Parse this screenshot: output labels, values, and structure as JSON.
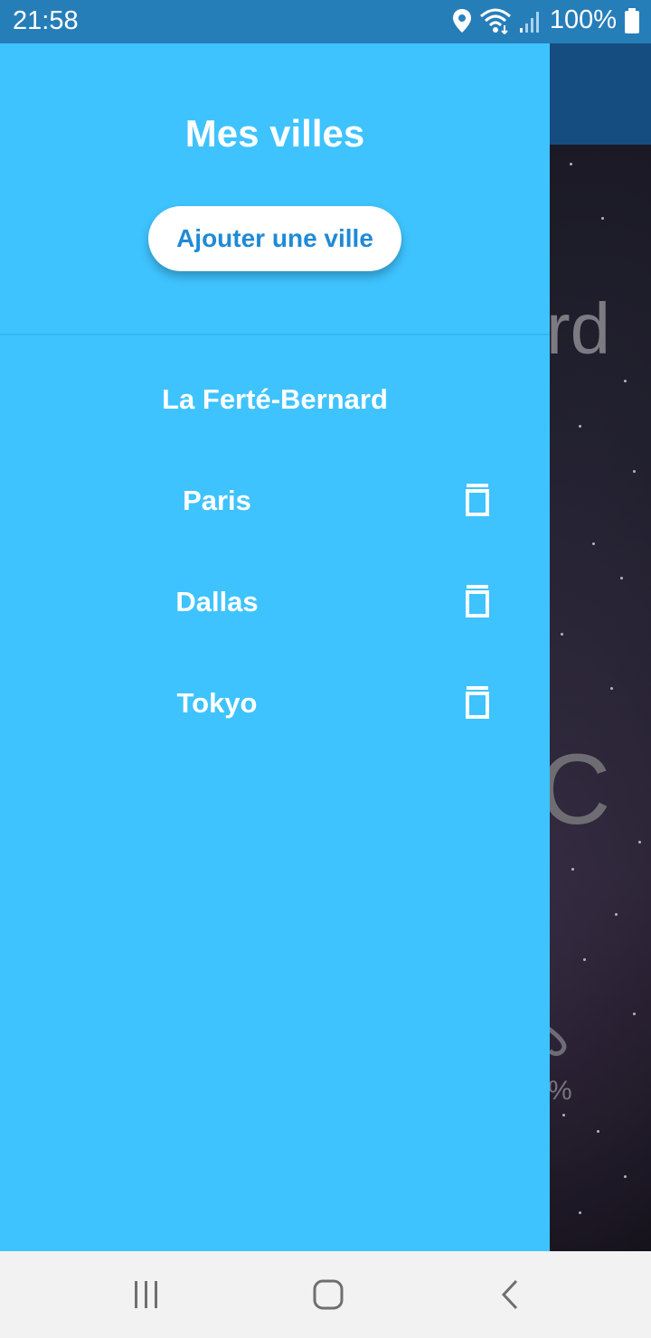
{
  "status_bar": {
    "time": "21:58",
    "battery_percent": "100%",
    "icons": [
      "location-icon",
      "wifi-icon",
      "signal-icon",
      "battery-icon"
    ]
  },
  "background_app": {
    "city_fragment": "rd",
    "temperature_fragment": "C",
    "humidity_fragment": "%"
  },
  "drawer": {
    "title": "Mes villes",
    "add_button_label": "Ajouter une ville",
    "current_city": "La Ferté-Bernard",
    "saved_cities": [
      {
        "name": "Paris",
        "delete_icon": "trash-icon"
      },
      {
        "name": "Dallas",
        "delete_icon": "trash-icon"
      },
      {
        "name": "Tokyo",
        "delete_icon": "trash-icon"
      }
    ]
  },
  "nav_bar": {
    "buttons": [
      "recent-apps-icon",
      "home-icon",
      "back-icon"
    ]
  },
  "colors": {
    "drawer_background": "#3ec3fe",
    "button_text": "#1f8ad6",
    "app_bar": "#154d80",
    "status_bar": "#2882be"
  }
}
